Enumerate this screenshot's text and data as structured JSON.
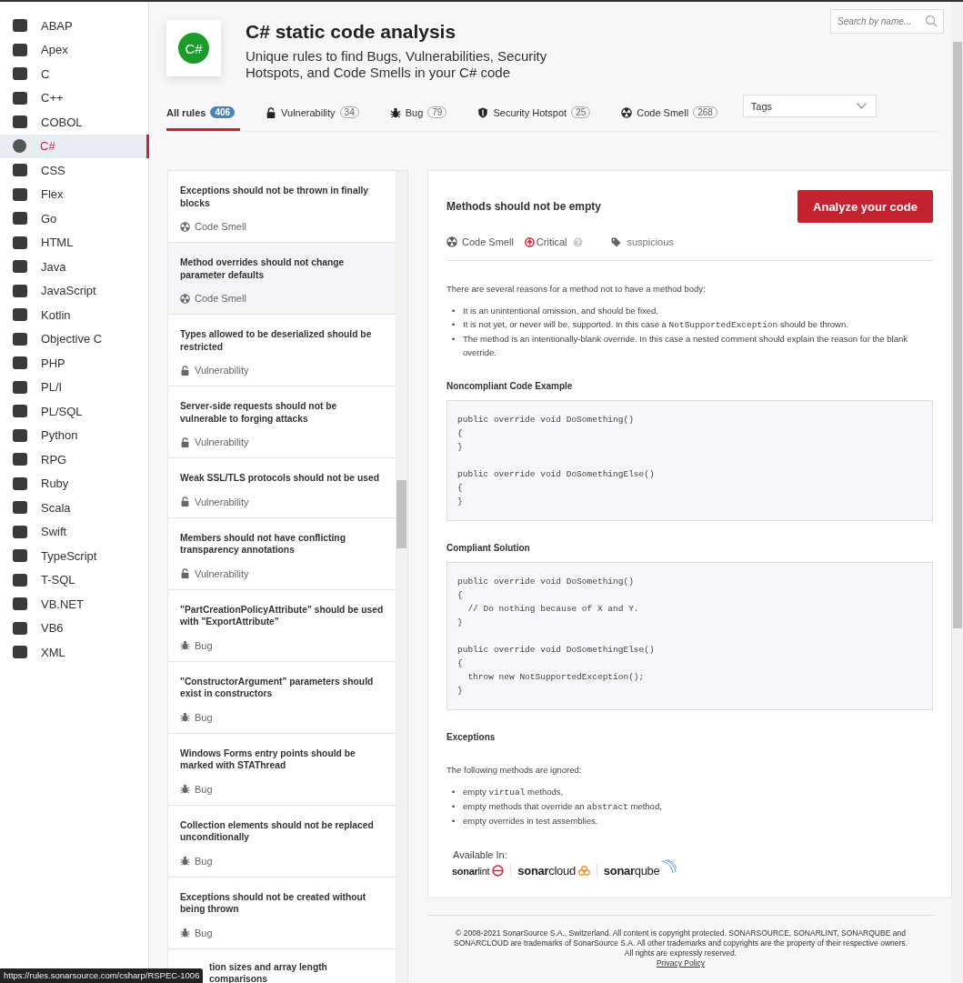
{
  "sidebar": {
    "languages": [
      {
        "name": "ABAP",
        "selected": false
      },
      {
        "name": "Apex",
        "selected": false
      },
      {
        "name": "C",
        "selected": false
      },
      {
        "name": "C++",
        "selected": false
      },
      {
        "name": "COBOL",
        "selected": false
      },
      {
        "name": "C#",
        "selected": true
      },
      {
        "name": "CSS",
        "selected": false
      },
      {
        "name": "Flex",
        "selected": false
      },
      {
        "name": "Go",
        "selected": false
      },
      {
        "name": "HTML",
        "selected": false
      },
      {
        "name": "Java",
        "selected": false
      },
      {
        "name": "JavaScript",
        "selected": false
      },
      {
        "name": "Kotlin",
        "selected": false
      },
      {
        "name": "Objective C",
        "selected": false
      },
      {
        "name": "PHP",
        "selected": false
      },
      {
        "name": "PL/I",
        "selected": false
      },
      {
        "name": "PL/SQL",
        "selected": false
      },
      {
        "name": "Python",
        "selected": false
      },
      {
        "name": "RPG",
        "selected": false
      },
      {
        "name": "Ruby",
        "selected": false
      },
      {
        "name": "Scala",
        "selected": false
      },
      {
        "name": "Swift",
        "selected": false
      },
      {
        "name": "TypeScript",
        "selected": false
      },
      {
        "name": "T-SQL",
        "selected": false
      },
      {
        "name": "VB.NET",
        "selected": false
      },
      {
        "name": "VB6",
        "selected": false
      },
      {
        "name": "XML",
        "selected": false
      }
    ]
  },
  "header": {
    "logo_text": "C#",
    "title": "C# static code analysis",
    "subtitle": "Unique rules to find Bugs, Vulnerabilities, Security Hotspots, and Code Smells in your C# code",
    "search": {
      "placeholder": "Search by name..."
    }
  },
  "tabs": [
    {
      "label": "All rules",
      "count": "406",
      "kind": "all",
      "selected": true
    },
    {
      "label": "Vulnerability",
      "count": "34",
      "kind": "vulnerability",
      "selected": false
    },
    {
      "label": "Bug",
      "count": "79",
      "kind": "bug",
      "selected": false
    },
    {
      "label": "Security Hotspot",
      "count": "25",
      "kind": "hotspot",
      "selected": false
    },
    {
      "label": "Code Smell",
      "count": "268",
      "kind": "code_smell",
      "selected": false
    }
  ],
  "tags_dropdown": {
    "label": "Tags"
  },
  "rules": [
    {
      "title": "Exceptions should not be thrown in finally blocks",
      "type": "Code Smell",
      "kind": "code_smell",
      "selected": false
    },
    {
      "title": "Method overrides should not change parameter defaults",
      "type": "Code Smell",
      "kind": "code_smell",
      "selected": true
    },
    {
      "title": "Types allowed to be deserialized should be restricted",
      "type": "Vulnerability",
      "kind": "vulnerability",
      "selected": false
    },
    {
      "title": "Server-side requests should not be vulnerable to forging attacks",
      "type": "Vulnerability",
      "kind": "vulnerability",
      "selected": false
    },
    {
      "title": "Weak SSL/TLS protocols should not be used",
      "type": "Vulnerability",
      "kind": "vulnerability",
      "selected": false
    },
    {
      "title": "Members should not have conflicting transparency annotations",
      "type": "Vulnerability",
      "kind": "vulnerability",
      "selected": false
    },
    {
      "title": "\"PartCreationPolicyAttribute\" should be used with \"ExportAttribute\"",
      "type": "Bug",
      "kind": "bug",
      "selected": false
    },
    {
      "title": "\"ConstructorArgument\" parameters should exist in constructors",
      "type": "Bug",
      "kind": "bug",
      "selected": false
    },
    {
      "title": "Windows Forms entry points should be marked with STAThread",
      "type": "Bug",
      "kind": "bug",
      "selected": false
    },
    {
      "title": "Collection elements should not be replaced unconditionally",
      "type": "Bug",
      "kind": "bug",
      "selected": false
    },
    {
      "title": "Exceptions should not be created without being thrown",
      "type": "Bug",
      "kind": "bug",
      "selected": false
    }
  ],
  "rule_cut_off": "tion sizes and array length comparisons",
  "detail": {
    "title": "Methods should not be empty",
    "action_button": "Analyze your code",
    "type": {
      "label": "Code Smell",
      "kind": "code_smell"
    },
    "severity": "Critical",
    "tag": "suspicious",
    "sections": [
      {
        "kind": "text",
        "text": "There are several reasons for a method not to have a method body:"
      },
      {
        "kind": "list",
        "items": [
          {
            "marker": "•",
            "parts": [
              {
                "text": "It is an unintentional omission, and should be fixed.",
                "kind": "text"
              }
            ]
          },
          {
            "marker": "•",
            "parts": [
              {
                "text": "It is not yet, or never will be, supported. In this case a ",
                "kind": "text"
              },
              {
                "text": "NotSupportedException",
                "kind": "code"
              },
              {
                "text": " should be thrown.",
                "kind": "text"
              }
            ]
          },
          {
            "marker": "•",
            "parts": [
              {
                "text": "The method is an intentionally-blank override. In this case a nested comment should explain the reason for the blank override.",
                "kind": "text"
              }
            ]
          }
        ]
      },
      {
        "kind": "heading",
        "text": "Noncompliant Code Example"
      },
      {
        "kind": "code",
        "text": "public override void DoSomething()\n{\n}\n\npublic override void DoSomethingElse()\n{\n}"
      },
      {
        "kind": "heading",
        "text": "Compliant Solution"
      },
      {
        "kind": "code",
        "text": "public override void DoSomething()\n{\n  // Do nothing because of X and Y.\n}\n\npublic override void DoSomethingElse()\n{\n  throw new NotSupportedException();\n}"
      },
      {
        "kind": "heading",
        "text": "Exceptions"
      },
      {
        "kind": "text",
        "text": "The following methods are ignored:"
      },
      {
        "kind": "list",
        "items": [
          {
            "marker": "•",
            "parts": [
              {
                "text": "empty ",
                "kind": "text"
              },
              {
                "text": "virtual",
                "kind": "code"
              },
              {
                "text": " methods,",
                "kind": "text"
              }
            ]
          },
          {
            "marker": "•",
            "parts": [
              {
                "text": "empty methods that override an ",
                "kind": "text"
              },
              {
                "text": "abstract",
                "kind": "code"
              },
              {
                "text": " method,",
                "kind": "text"
              }
            ]
          },
          {
            "marker": "•",
            "parts": [
              {
                "text": "empty overrides in test assemblies.",
                "kind": "text"
              }
            ]
          }
        ]
      }
    ],
    "available_in": {
      "label": "Available In:",
      "products": [
        {
          "name": "**sonar**lint",
          "kind": "lint"
        },
        {
          "name": "**sonar**cloud",
          "kind": "cloud"
        },
        {
          "name": "**sonar**qube",
          "kind": "qube"
        }
      ]
    }
  },
  "footer": {
    "copyright": "© 2008-2021 SonarSource S.A., Switzerland. All content is copyright protected. SONARSOURCE, SONARLINT, SONARQUBE and SONARCLOUD are trademarks of SonarSource S.A. All other trademarks and copyrights are the property of their respective owners.",
    "rights": "All rights are expressly reserved.",
    "privacy_link": "Privacy Policy"
  },
  "status_bar": {
    "url": "https://rules.sonarsource.com/csharp/RSPEC-1006"
  }
}
